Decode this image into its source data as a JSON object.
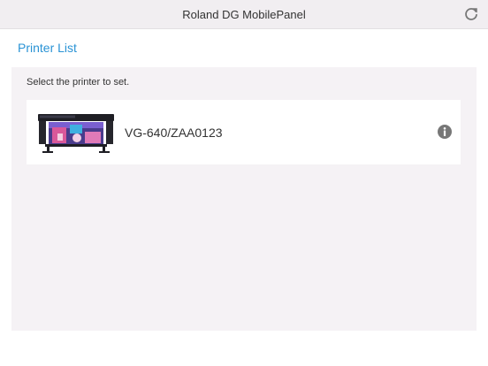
{
  "app": {
    "title": "Roland DG MobilePanel"
  },
  "icons": {
    "refresh": "refresh-icon",
    "info": "info-icon",
    "printer_image": "printer-thumbnail"
  },
  "colors": {
    "accent": "#2a93d5",
    "titlebar_bg": "#f1eef1",
    "panel_bg": "#f5f2f5",
    "text": "#333333",
    "icon_gray": "#777777"
  },
  "printer_list": {
    "heading": "Printer List",
    "instruction": "Select the printer to set.",
    "printers": [
      {
        "name": "VG-640/ZAA0123"
      }
    ]
  }
}
